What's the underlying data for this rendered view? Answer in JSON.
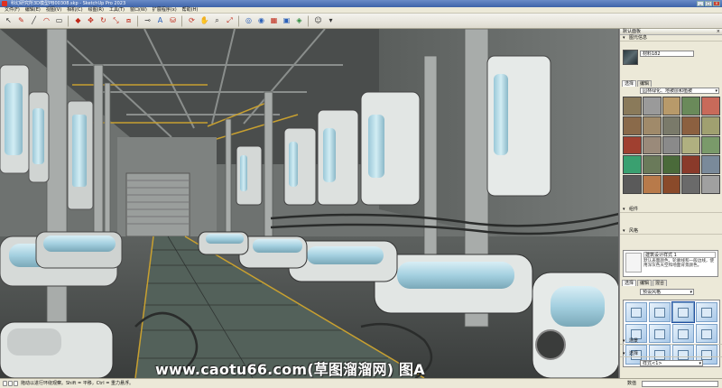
{
  "window": {
    "title": "科幻研究所3D模型PB00308.skp - SketchUp Pro 2023",
    "buttons": [
      "_",
      "□",
      "×"
    ]
  },
  "menu": [
    "文件(F)",
    "编辑(E)",
    "视图(V)",
    "相机(C)",
    "绘图(R)",
    "工具(T)",
    "窗口(W)",
    "扩展程序(x)",
    "帮助(H)"
  ],
  "toolbar": {
    "tools": [
      {
        "name": "select-tool-icon",
        "glyph": "↖",
        "tone": ""
      },
      {
        "name": "eraser-tool-icon",
        "glyph": "✎",
        "tone": "r"
      },
      {
        "name": "line-tool-icon",
        "glyph": "╱",
        "tone": ""
      },
      {
        "name": "arc-tool-icon",
        "glyph": "◠",
        "tone": "r"
      },
      {
        "name": "shape-tool-icon",
        "glyph": "▭",
        "tone": ""
      },
      {
        "name": "sep",
        "glyph": "",
        "tone": ""
      },
      {
        "name": "push-pull-tool-icon",
        "glyph": "◆",
        "tone": "r"
      },
      {
        "name": "move-tool-icon",
        "glyph": "✥",
        "tone": "r"
      },
      {
        "name": "rotate-tool-icon",
        "glyph": "↻",
        "tone": "r"
      },
      {
        "name": "scale-tool-icon",
        "glyph": "⤡",
        "tone": "r"
      },
      {
        "name": "offset-tool-icon",
        "glyph": "⧈",
        "tone": "r"
      },
      {
        "name": "sep",
        "glyph": "",
        "tone": ""
      },
      {
        "name": "tape-measure-icon",
        "glyph": "⊸",
        "tone": ""
      },
      {
        "name": "text-tool-icon",
        "glyph": "A",
        "tone": "b"
      },
      {
        "name": "paint-bucket-icon",
        "glyph": "⛁",
        "tone": "r"
      },
      {
        "name": "sep",
        "glyph": "",
        "tone": ""
      },
      {
        "name": "orbit-tool-icon",
        "glyph": "⟳",
        "tone": "r"
      },
      {
        "name": "pan-tool-icon",
        "glyph": "✋",
        "tone": ""
      },
      {
        "name": "zoom-tool-icon",
        "glyph": "⌕",
        "tone": ""
      },
      {
        "name": "zoom-extents-icon",
        "glyph": "⤢",
        "tone": "r"
      },
      {
        "name": "sep",
        "glyph": "",
        "tone": ""
      },
      {
        "name": "warehouse-icon",
        "glyph": "◎",
        "tone": "b"
      },
      {
        "name": "extension-warehouse-icon",
        "glyph": "◉",
        "tone": "b"
      },
      {
        "name": "extension-manager-icon",
        "glyph": "▦",
        "tone": "r"
      },
      {
        "name": "layout-icon",
        "glyph": "▣",
        "tone": "b"
      },
      {
        "name": "style-builder-icon",
        "glyph": "◈",
        "tone": "g"
      },
      {
        "name": "sep",
        "glyph": "",
        "tone": ""
      },
      {
        "name": "account-icon",
        "glyph": "☺",
        "tone": ""
      },
      {
        "name": "account-dropdown-icon",
        "glyph": "▾",
        "tone": ""
      }
    ]
  },
  "panel": {
    "title": "默认面板",
    "materials_section": "图元信息",
    "material_name": "材料182",
    "tabs_materials": [
      "选择",
      "编辑"
    ],
    "materials_combo": "园林绿化、地被层和植被",
    "material_swatches": [
      "#8a7a5a",
      "#9a9a9a",
      "#b89a6a",
      "#6a8a5a",
      "#c86a5a",
      "#8a6a4a",
      "#a08a6a",
      "#7a7a6a",
      "#8c6040",
      "#a0a070",
      "#a04030",
      "#9a8a7a",
      "#8a8a8a",
      "#b0b080",
      "#7a9a6a",
      "#3aa070",
      "#6a7a5a",
      "#4a6a3a",
      "#8a3a2a",
      "#7a8a9a",
      "#5a5a5a",
      "#b87a4a",
      "#8a4a2a",
      "#6a6a6a",
      "#a0a0a0"
    ],
    "section_components": "组件",
    "section_styles": "风格",
    "tabs_styles": [
      "选择",
      "编辑",
      "混合"
    ],
    "style_title": "建筑设计样式 1",
    "style_desc": "默认表面颜色，轮廓线和一般边线，使用深灰色天空和地面背景颜色。",
    "styles_combo": "预设风格",
    "section_shadows": "场景",
    "section_bottom": "选择",
    "bottom_combo": "样式<1>"
  },
  "status": {
    "text": "拖动以进行环绕观察。Shift = 平移，Ctrl = 重力悬浮。",
    "value_label": "数值"
  },
  "watermark": "www.caotu66.com(草图溜溜网) 图A"
}
